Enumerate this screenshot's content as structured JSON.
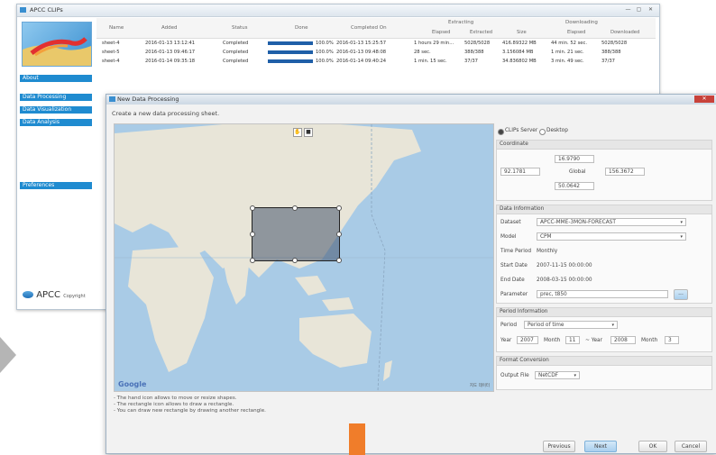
{
  "bg_window": {
    "title": "APCC CLIPs",
    "controls": [
      "—",
      "▢",
      "✕"
    ],
    "nav": [
      "About",
      "Data Processing",
      "Data Visualization",
      "Data Analysis",
      "Preferences"
    ],
    "brand": "APCC",
    "copyright": "Copyright",
    "table": {
      "headers": [
        "Name",
        "Added",
        "Status",
        "Done",
        "Completed On"
      ],
      "group_extracting": "Extracting",
      "group_downloading": "Downloading",
      "sub_extracting": [
        "Elapsed",
        "Extracted",
        "Size"
      ],
      "sub_downloading": [
        "Elapsed",
        "Downloaded"
      ],
      "rows": [
        {
          "name": "sheet-4",
          "added": "2016-01-13 13:12:41",
          "status": "Completed",
          "done": "100.0%",
          "completed": "2016-01-13 15:25:57",
          "elapsed": "1 hours 29 min...",
          "extracted": "5028/5028",
          "size": "416.89322 MB",
          "d_elapsed": "44 min. 52 sec.",
          "downloaded": "5028/5028"
        },
        {
          "name": "sheet-5",
          "added": "2016-01-13 09:46:17",
          "status": "Completed",
          "done": "100.0%",
          "completed": "2016-01-13 09:48:08",
          "elapsed": "28 sec.",
          "extracted": "388/388",
          "size": "3.156084 MB",
          "d_elapsed": "1 min. 21 sec.",
          "downloaded": "388/388"
        },
        {
          "name": "sheet-4",
          "added": "2016-01-14 09:35:18",
          "status": "Completed",
          "done": "100.0%",
          "completed": "2016-01-14 09:40:24",
          "elapsed": "1 min. 15 sec.",
          "extracted": "37/37",
          "size": "34.836802 MB",
          "d_elapsed": "3 min. 49 sec.",
          "downloaded": "37/37"
        }
      ]
    }
  },
  "dialog": {
    "title": "New Data Processing",
    "close": "✕",
    "subtitle": "Create a new data processing sheet.",
    "map_logo": "Google",
    "map_attrib": "지도 데이터",
    "map_tools": [
      "✋",
      "■"
    ],
    "notes": [
      "- The hand icon allows to move or resize shapes.",
      "- The rectangle icon allows to draw a rectangle.",
      "- You can draw new rectangle by drawing another rectangle."
    ],
    "source_options": [
      "CLIPs Server",
      "Desktop"
    ],
    "source_selected": "CLIPs Server",
    "coordinate": {
      "heading": "Coordinate",
      "north": "16.9790",
      "west": "92.1781",
      "global_label": "Global",
      "east": "156.3672",
      "south": "50.0642"
    },
    "info": {
      "heading": "Data Information",
      "dataset_label": "Dataset",
      "dataset": "APCC-MME-3MON-FORECAST",
      "model_label": "Model",
      "model": "CPM",
      "time_period_label": "Time Period",
      "time_period": "Monthly",
      "start_label": "Start Date",
      "start": "2007-11-15 00:00:00",
      "end_label": "End Date",
      "end": "2008-03-15 00:00:00",
      "param_label": "Parameter",
      "param": "prec, t850",
      "param_btn": "..."
    },
    "period": {
      "heading": "Period Information",
      "period_label": "Period",
      "period": "Period of time",
      "year_label": "Year",
      "year_from": "2007",
      "month_label": "Month",
      "month_from": "11",
      "sep": "~ Year",
      "year_to": "2008",
      "month_to": "3"
    },
    "format": {
      "heading": "Format Conversion",
      "output_label": "Output File",
      "output": "NetCDF"
    },
    "buttons": {
      "previous": "Previous",
      "next": "Next",
      "ok": "OK",
      "cancel": "Cancel"
    }
  },
  "colors": {
    "accent": "#1f8bd0",
    "selection": "#6f7f8f",
    "map_water": "#a9cbe6",
    "map_land": "#e8e5d8"
  }
}
